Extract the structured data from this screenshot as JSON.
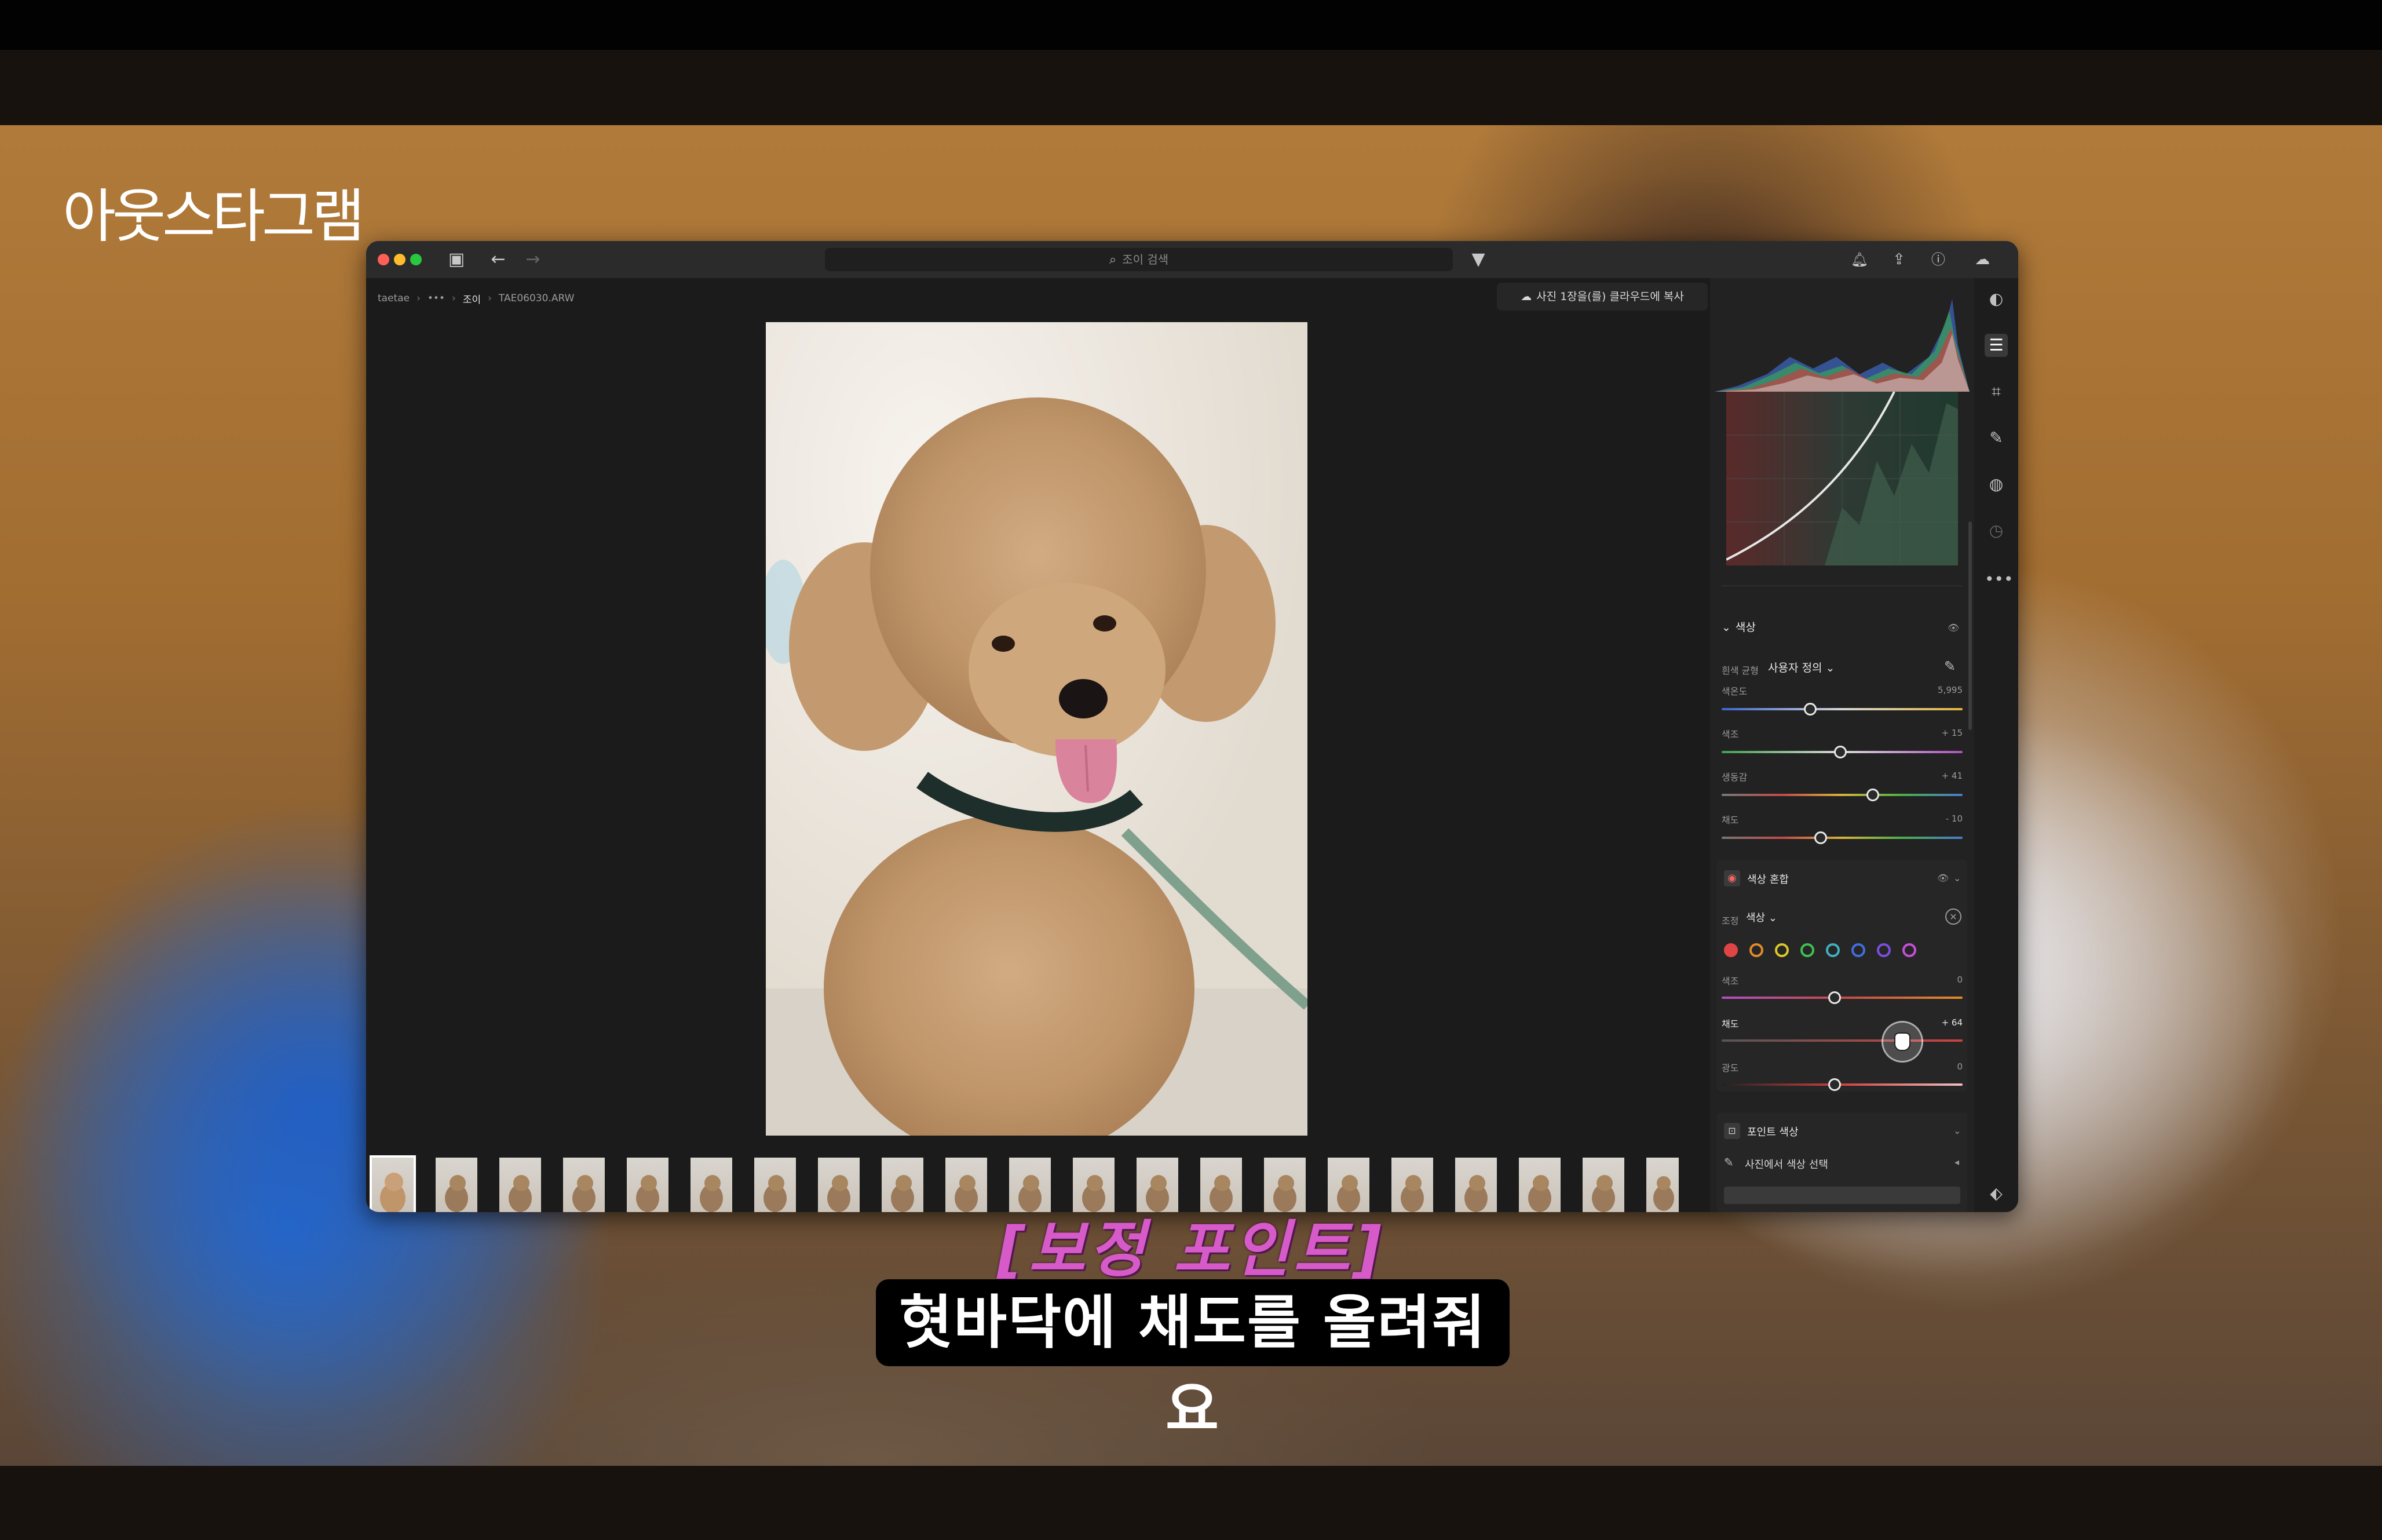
{
  "overlay": {
    "watermark": "아웃스타그램",
    "subtitle_point": "[보정 포인트]",
    "subtitle_caption": "혓바닥에 채도를 올려줘요"
  },
  "titlebar": {
    "search_placeholder": "조이 검색"
  },
  "breadcrumb": {
    "root": "taetae",
    "ellipsis": "•••",
    "album": "조이",
    "file": "TAE06030.ARW"
  },
  "toolbar": {
    "copy_to_cloud_label": "사진 1장을(를) 클라우드에 복사"
  },
  "color_panel": {
    "section_title": "색상",
    "white_balance_label": "흰색 균형",
    "white_balance_value": "사용자 정의",
    "sliders": [
      {
        "label": "색온도",
        "value": "5,995"
      },
      {
        "label": "색조",
        "value": "+ 15"
      },
      {
        "label": "생동감",
        "value": "+ 41"
      },
      {
        "label": "채도",
        "value": "- 10"
      }
    ]
  },
  "color_mix": {
    "section_title": "색상 혼합",
    "adjust_label": "조정",
    "adjust_value": "색상",
    "swatch_colors": [
      "#e04545",
      "#e08a2a",
      "#d8c82a",
      "#3fbf52",
      "#3fb0c0",
      "#3f6ee0",
      "#7a4fe0",
      "#c64fd8"
    ],
    "sliders": [
      {
        "label": "색조",
        "value": "0"
      },
      {
        "label": "채도",
        "value": "+ 64"
      },
      {
        "label": "광도",
        "value": "0"
      }
    ]
  },
  "point_color": {
    "section_title": "포인트 색상",
    "pick_label": "사진에서 색상 선택"
  },
  "colors": {
    "accent_pink": "#d65bc9",
    "panel_bg": "#222222"
  }
}
